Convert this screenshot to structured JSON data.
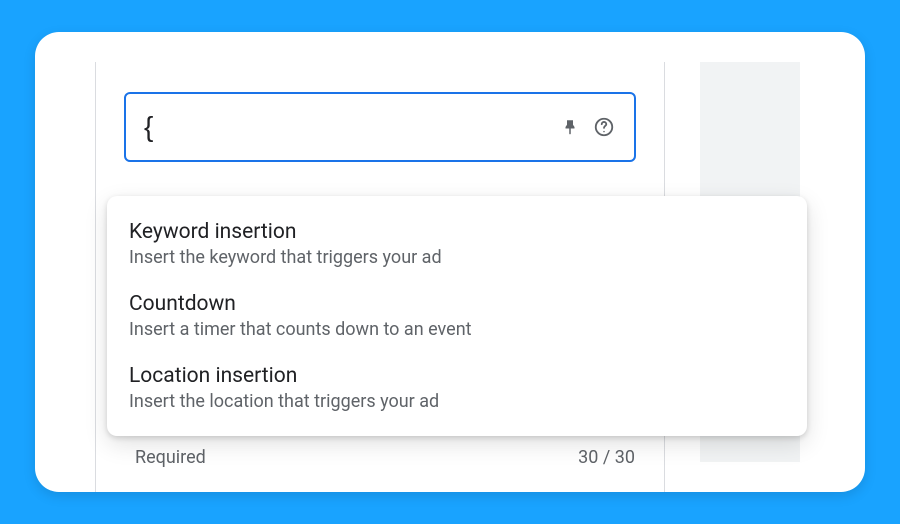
{
  "input": {
    "value": "{"
  },
  "dropdown": {
    "items": [
      {
        "title": "Keyword insertion",
        "desc": "Insert the keyword that triggers your ad"
      },
      {
        "title": "Countdown",
        "desc": "Insert a timer that counts down to an event"
      },
      {
        "title": "Location insertion",
        "desc": "Insert the location that triggers your ad"
      }
    ]
  },
  "footer": {
    "label": "Required",
    "counter": "30 / 30"
  }
}
